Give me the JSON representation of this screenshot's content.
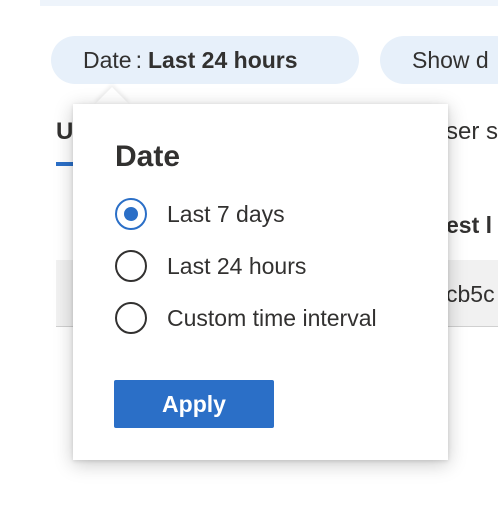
{
  "filters": {
    "date_pill": {
      "label": "Date",
      "separator": ":",
      "value": "Last 24 hours"
    },
    "show_pill": {
      "label": "Show d"
    }
  },
  "background": {
    "tab_fragment": "U",
    "header_fragment": "ser s",
    "column_fragment": "est l",
    "cell_fragment": "cb5c"
  },
  "date_popover": {
    "title": "Date",
    "options": [
      {
        "label": "Last 7 days",
        "selected": true
      },
      {
        "label": "Last 24 hours",
        "selected": false
      },
      {
        "label": "Custom time interval",
        "selected": false
      }
    ],
    "apply_label": "Apply"
  },
  "colors": {
    "accent": "#2b6fc7",
    "pill_background": "#e7f0fa",
    "text": "#323130"
  }
}
